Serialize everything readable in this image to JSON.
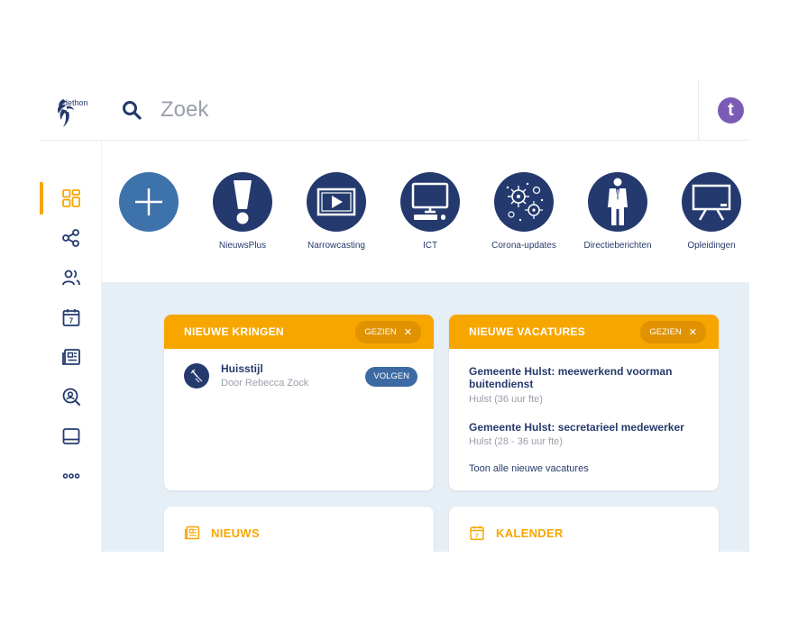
{
  "header": {
    "logo_text": "dethon",
    "search_placeholder": "Zoek",
    "avatar_letter": "t",
    "avatar_color": "#7b5bb6"
  },
  "colors": {
    "accent": "#f7a600",
    "navy": "#243a6e",
    "content_bg": "#e6eef6",
    "button_blue": "#3d6aa3"
  },
  "sidebar": {
    "items": [
      {
        "icon": "dashboard-icon",
        "active": true
      },
      {
        "icon": "share-network-icon",
        "active": false
      },
      {
        "icon": "people-icon",
        "active": false
      },
      {
        "icon": "calendar-icon",
        "active": false
      },
      {
        "icon": "news-icon",
        "active": false
      },
      {
        "icon": "search-person-icon",
        "active": false
      },
      {
        "icon": "tablet-icon",
        "active": false
      },
      {
        "icon": "more-icon",
        "active": false
      }
    ]
  },
  "quicklinks": [
    {
      "label": "",
      "icon": "plus-icon"
    },
    {
      "label": "NieuwsPlus",
      "icon": "exclamation-icon"
    },
    {
      "label": "Narrowcasting",
      "icon": "play-screen-icon"
    },
    {
      "label": "ICT",
      "icon": "computer-icon"
    },
    {
      "label": "Corona-updates",
      "icon": "virus-icon"
    },
    {
      "label": "Directieberichten",
      "icon": "director-icon"
    },
    {
      "label": "Opleidingen",
      "icon": "presentation-board-icon"
    }
  ],
  "kringen": {
    "title": "NIEUWE KRINGEN",
    "seen_label": "GEZIEN",
    "item": {
      "name": "Huisstijl",
      "by": "Door Rebecca Zock",
      "follow_label": "VOLGEN"
    }
  },
  "vacatures": {
    "title": "NIEUWE VACATURES",
    "seen_label": "GEZIEN",
    "items": [
      {
        "title": "Gemeente Hulst: meewerkend voorman buitendienst",
        "sub": "Hulst (36 uur fte)"
      },
      {
        "title": "Gemeente Hulst: secretarieel medewerker",
        "sub": "Hulst (28 - 36 uur fte)"
      }
    ],
    "all_link": "Toon alle nieuwe vacatures"
  },
  "nieuws": {
    "title": "NIEUWS"
  },
  "kalender": {
    "title": "KALENDER"
  }
}
